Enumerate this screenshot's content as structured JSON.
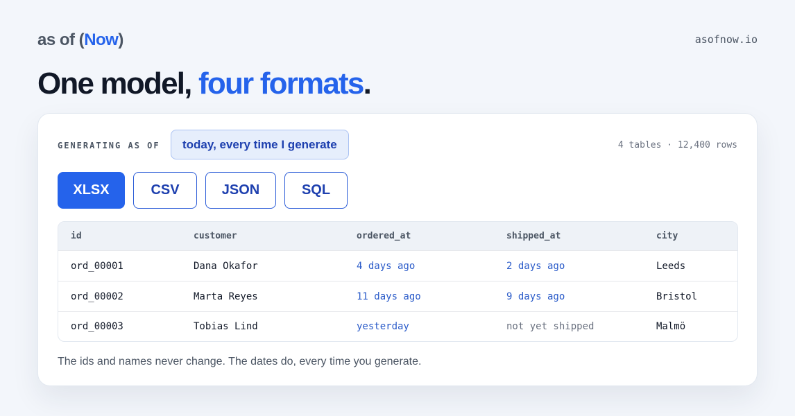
{
  "header": {
    "brand_prefix": "as of (",
    "brand_accent": "Now",
    "brand_suffix": ")",
    "domain": "asofnow.io"
  },
  "headline": {
    "part1": "One model, ",
    "accent": "four formats",
    "period": "."
  },
  "card": {
    "generating_label": "GENERATING AS OF",
    "generating_value": "today, every time I generate",
    "stats": "4 tables · 12,400 rows",
    "formats": [
      "XLSX",
      "CSV",
      "JSON",
      "SQL"
    ],
    "selected_format": "XLSX",
    "table": {
      "columns": [
        "id",
        "customer",
        "ordered_at",
        "shipped_at",
        "city"
      ],
      "rows": [
        [
          "ord_00001",
          "Dana Okafor",
          "4 days ago",
          "2 days ago",
          "Leeds"
        ],
        [
          "ord_00002",
          "Marta Reyes",
          "11 days ago",
          "9 days ago",
          "Bristol"
        ],
        [
          "ord_00003",
          "Tobias Lind",
          "yesterday",
          "not yet shipped",
          "Malmö"
        ]
      ]
    },
    "footnote": "The ids and names never change. The dates do, every time you generate."
  },
  "colors": {
    "accent": "#2563eb",
    "background": "#f3f6fb",
    "date_text": "#2a5bc9"
  }
}
